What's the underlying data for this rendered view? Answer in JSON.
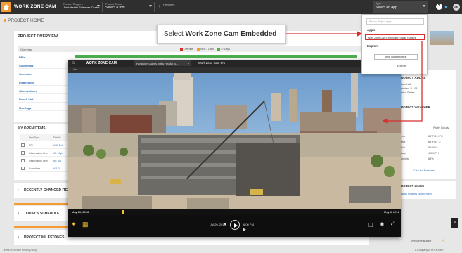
{
  "topbar": {
    "brand": "WORK ZONE CAM",
    "project_label": "Rowan Rutgers",
    "project_value": "Joint Health Sciences Center",
    "tools_label": "Project Tools",
    "tools_value": "Select a tool",
    "favorites_label": "Favorites",
    "user_label": "Apps",
    "user_value": "Select an App",
    "help_glyph": "?",
    "avatar_initials": "SB"
  },
  "dropdown": {
    "search_placeholder": "Search Project Apps",
    "apps_header": "Apps",
    "app_item": "Work Zone Cam Embedded Rowan Rutgers",
    "explore_header": "Explore",
    "marketplace_button": "App Marketplace",
    "manage_label": "nment"
  },
  "callout": {
    "prefix": "Select ",
    "bold": "Work Zone Cam Embedded"
  },
  "page": {
    "project_home": "PROJECT HOME",
    "overview_title": "PROJECT OVERVIEW",
    "overview_header": "Overview",
    "legend": [
      "Overdue",
      "Next 7 Days",
      ">7 Days"
    ],
    "legend_colors": [
      "#d62f2f",
      "#f39c33",
      "#4caf50"
    ],
    "overview_rows": [
      "RFIs",
      "Submittals",
      "Schedule",
      "Inspections",
      "Observations",
      "Punch List",
      "Meetings"
    ],
    "open_items_title": "MY OPEN ITEMS",
    "open_items_header": [
      "Item Type",
      "Details"
    ],
    "open_items": [
      {
        "type": "RFI",
        "num": "#13: Ext"
      },
      {
        "type": "Observation Item",
        "num": "#5: High"
      },
      {
        "type": "Observation Item",
        "num": "#5: Ma"
      },
      {
        "type": "Submittals",
        "num": "#11-01"
      }
    ],
    "recently_changed": "RECENTLY CHANGED ITEMS",
    "todays_schedule": "TODAY'S SCHEDULE",
    "project_milestones": "PROJECT MILESTONES",
    "footer": "Terms of Service  Privacy Policy",
    "footer_right": "A Company of PROCORE"
  },
  "right": {
    "address_title": "PROJECT ADDRE",
    "address_lines": [
      "Glass Hall",
      "Camden, NJ 08",
      "United States"
    ],
    "weather_title": "PROJECT WEATHER",
    "weather_cond": "Partly Cloudy",
    "weather_rows": [
      [
        "Temp",
        "88°F/31.0°C"
      ],
      [
        "Feels",
        "88°F/31°C"
      ],
      [
        "Wind",
        "5 MPH"
      ],
      [
        "Dewpt",
        "4.0 MPH"
      ],
      [
        "Humidity",
        "68%"
      ]
    ],
    "click_forecast": "Click for Forecast",
    "links_title": "PROJECT LINKS",
    "links_text": "Rowan Rutgers joint project",
    "welcome": "Welcome Builder"
  },
  "player": {
    "brand": "WORK ZONE CAM",
    "tab": "Rowan Rutgers Joint Health S...",
    "camera": "Work Zone Cam Pro",
    "sub": "Live",
    "ts_left": "May 20, 2018",
    "ts_right": "May 8, 2018",
    "date": "Jul 20, 2018",
    "time": "6:00 PM"
  }
}
